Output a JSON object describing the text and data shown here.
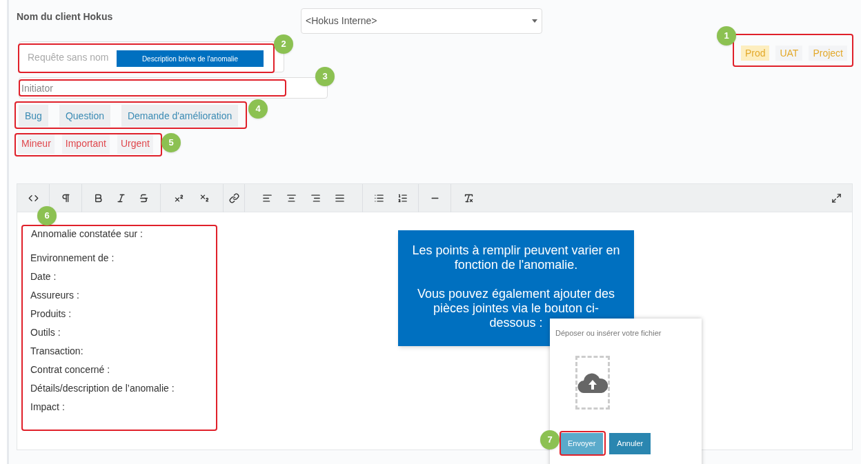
{
  "client": {
    "label": "Nom du client Hokus",
    "select_value": "<Hokus Interne>"
  },
  "environments": [
    {
      "label": "Prod",
      "selected": true
    },
    {
      "label": "UAT",
      "selected": false
    },
    {
      "label": "Project",
      "selected": false
    }
  ],
  "title_field": {
    "placeholder": "Requête sans nom"
  },
  "title_hint": "Description brève de l'anomalie",
  "initiator": {
    "placeholder": "Initiator"
  },
  "types": [
    {
      "label": "Bug",
      "selected": false
    },
    {
      "label": "Question",
      "selected": false
    },
    {
      "label": "Demande d'amélioration",
      "selected": false
    }
  ],
  "priorities": [
    {
      "label": "Mineur",
      "selected": false
    },
    {
      "label": "Important",
      "selected": false
    },
    {
      "label": "Urgent",
      "selected": false
    }
  ],
  "editor_lines": [
    "Annomalie constatée sur :",
    "Environnement de :",
    "Date :",
    "Assureurs :",
    "Produits :",
    "Outils :",
    "Transaction:",
    "Contrat concerné :",
    "Détails/description de l’anomalie :",
    "Impact :"
  ],
  "note": {
    "paragraphs": [
      "Les points à remplir peuvent varier en fonction de l'anomalie.",
      "Vous pouvez également ajouter des pièces jointes via le bouton ci-dessous :"
    ]
  },
  "upload": {
    "title": "Déposer ou insérer votre fichier",
    "buttons": [
      {
        "label": "Envoyer",
        "kind": "light"
      },
      {
        "label": "Annuler",
        "kind": "dark"
      }
    ]
  },
  "callouts": [
    {
      "number": "1"
    },
    {
      "number": "2"
    },
    {
      "number": "3"
    },
    {
      "number": "4"
    },
    {
      "number": "5"
    },
    {
      "number": "6"
    },
    {
      "number": "7"
    }
  ]
}
